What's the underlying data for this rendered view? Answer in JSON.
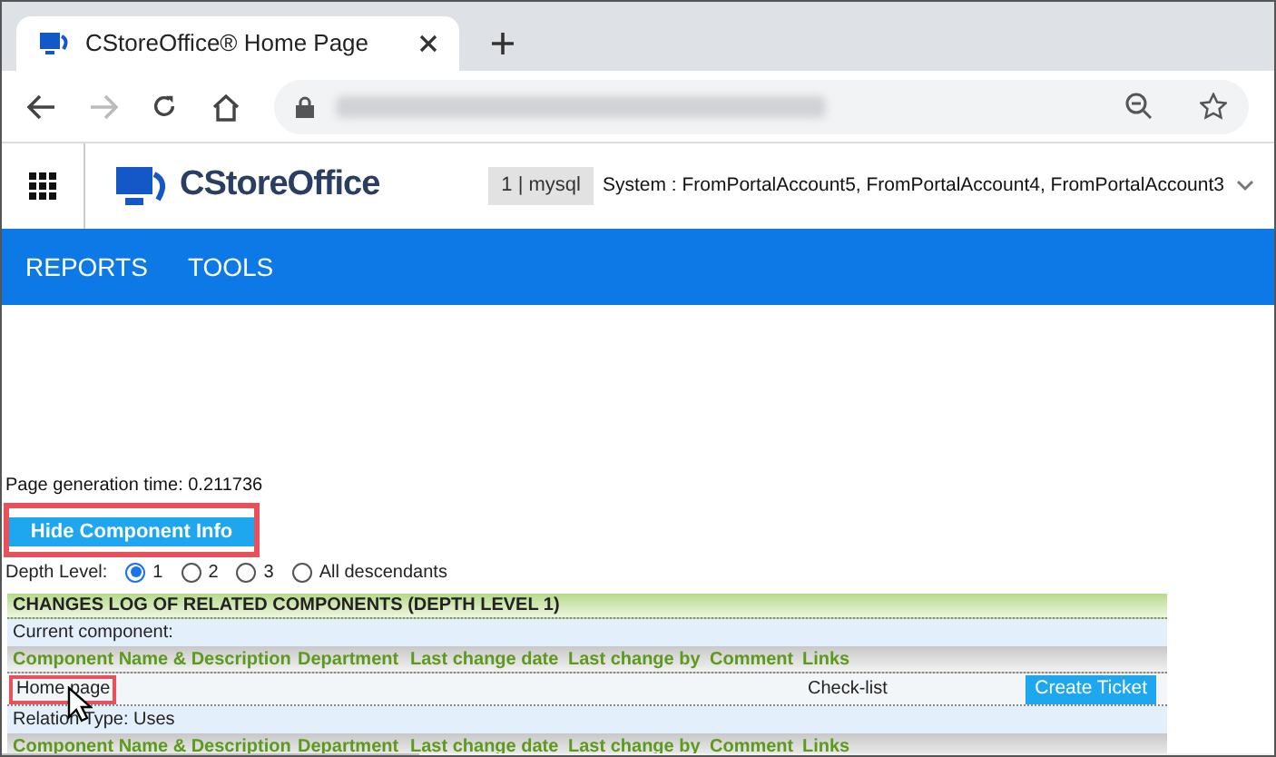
{
  "browser": {
    "tab_title": "CStoreOffice® Home Page"
  },
  "header": {
    "logo_text": "CStoreOffice",
    "db_badge": "1 | mysql",
    "system": "System : FromPortalAccount5, FromPortalAccount4, FromPortalAccount3"
  },
  "nav": {
    "items": [
      "REPORTS",
      "TOOLS"
    ]
  },
  "page_generation": "Page generation time: 0.211736",
  "toggle_button": "Hide Component Info",
  "depth": {
    "label": "Depth Level:",
    "options": [
      {
        "label": "1",
        "selected": true
      },
      {
        "label": "2",
        "selected": false
      },
      {
        "label": "3",
        "selected": false
      },
      {
        "label": "All descendants",
        "selected": false
      }
    ]
  },
  "changes_log": {
    "title": "CHANGES LOG OF RELATED COMPONENTS (DEPTH LEVEL 1)",
    "sections": [
      {
        "caption": "Current component:",
        "columns": [
          "Component Name & Description",
          "Department",
          "Last change date",
          "Last change by",
          "Comment",
          "Links"
        ],
        "rows": [
          {
            "name": "Home page",
            "department": "Check-list",
            "action": "Create Ticket"
          }
        ]
      },
      {
        "caption": "Relation Type: Uses",
        "columns": [
          "Component Name & Description",
          "Department",
          "Last change date",
          "Last change by",
          "Comment",
          "Links"
        ]
      }
    ]
  }
}
